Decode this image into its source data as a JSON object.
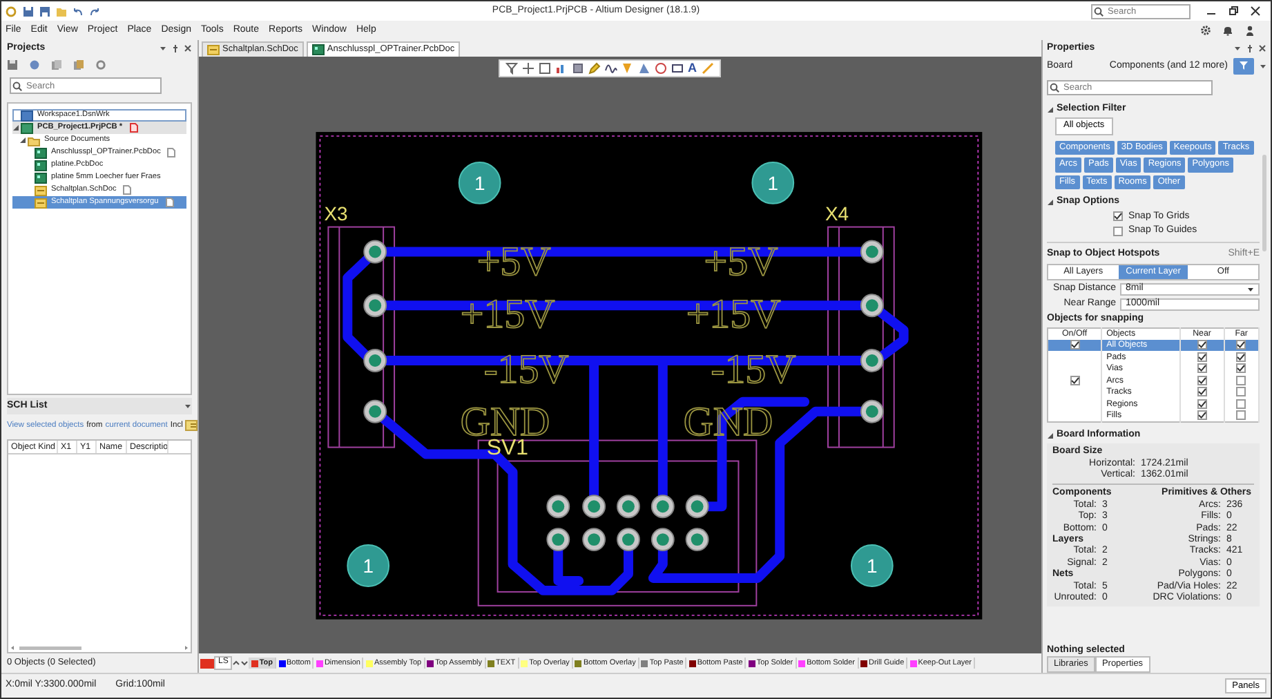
{
  "window": {
    "title": "PCB_Project1.PrjPCB - Altium Designer (18.1.9)",
    "search_placeholder": "Search"
  },
  "menu": [
    "File",
    "Edit",
    "View",
    "Project",
    "Place",
    "Design",
    "Tools",
    "Route",
    "Reports",
    "Window",
    "Help"
  ],
  "projects_panel": {
    "title": "Projects",
    "search_placeholder": "Search",
    "tree": [
      {
        "label": "Workspace1.DsnWrk",
        "kind": "workspace",
        "focused": true,
        "selected": false,
        "open": false
      },
      {
        "label": "PCB_Project1.PrjPCB *",
        "kind": "project",
        "focused": false,
        "selected": false,
        "open": true,
        "expanded": true,
        "children": [
          {
            "label": "Source Documents",
            "kind": "folder",
            "focused": false,
            "selected": false,
            "open": false,
            "expanded": true,
            "children": [
              {
                "label": "Anschlusspl_OPTrainer.PcbDoc",
                "kind": "pcb",
                "focused": false,
                "selected": false,
                "open": true
              },
              {
                "label": "platine.PcbDoc",
                "kind": "pcb",
                "focused": false,
                "selected": false,
                "open": false
              },
              {
                "label": "platine 5mm Loecher fuer Fraes",
                "kind": "pcb",
                "focused": false,
                "selected": false,
                "open": false
              },
              {
                "label": "Schaltplan.SchDoc",
                "kind": "sch",
                "focused": false,
                "selected": false,
                "open": true
              },
              {
                "label": "Schaltplan Spannungsversorgu",
                "kind": "sch",
                "focused": false,
                "selected": true,
                "open": true
              }
            ]
          }
        ]
      }
    ]
  },
  "sch_list": {
    "title": "SCH List",
    "description": [
      {
        "text": "View selected objects",
        "kind": "link"
      },
      {
        "text": "from",
        "kind": "plain"
      },
      {
        "text": "current document",
        "kind": "link"
      },
      {
        "text": "Incl",
        "kind": "plain"
      }
    ],
    "columns": [
      "Object Kind",
      "X1",
      "Y1",
      "Name",
      "Descriptio"
    ],
    "footer": "0 Objects (0 Selected)"
  },
  "doc_tabs": [
    {
      "label": "Schaltplan.SchDoc",
      "kind": "sch",
      "selected": false
    },
    {
      "label": "Anschlusspl_OPTrainer.PcbDoc",
      "kind": "pcb",
      "selected": true
    }
  ],
  "canvas_toolbar": {
    "text_tool_label": "A"
  },
  "pcb": {
    "designators": [
      "X3",
      "X4",
      "SV1"
    ],
    "net_labels": [
      "+5V",
      "+5V",
      "+15V",
      "+15V",
      "-15V",
      "-15V",
      "GND",
      "GND"
    ],
    "hole_labels": [
      "1",
      "1",
      "1",
      "1"
    ]
  },
  "layer_bar": {
    "current_layer": {
      "color": "#e03020"
    },
    "set_label": "LS",
    "layers": [
      {
        "name": "Top",
        "color": "#e03020",
        "selected": true
      },
      {
        "name": "Bottom",
        "color": "#0000ff",
        "selected": false
      },
      {
        "name": "Dimension",
        "color": "#ff40ff",
        "selected": false
      },
      {
        "name": "Assembly Top",
        "color": "#ffff60",
        "selected": false
      },
      {
        "name": "Top Assembly",
        "color": "#800080",
        "selected": false
      },
      {
        "name": "TEXT",
        "color": "#808020",
        "selected": false
      },
      {
        "name": "Top Overlay",
        "color": "#ffff80",
        "selected": false
      },
      {
        "name": "Bottom Overlay",
        "color": "#808020",
        "selected": false
      },
      {
        "name": "Top Paste",
        "color": "#808080",
        "selected": false
      },
      {
        "name": "Bottom Paste",
        "color": "#800000",
        "selected": false
      },
      {
        "name": "Top Solder",
        "color": "#800080",
        "selected": false
      },
      {
        "name": "Bottom Solder",
        "color": "#ff40ff",
        "selected": false
      },
      {
        "name": "Drill Guide",
        "color": "#800000",
        "selected": false
      },
      {
        "name": "Keep-Out Layer",
        "color": "#ff40ff",
        "selected": false
      }
    ]
  },
  "properties": {
    "title": "Properties",
    "object": "Board",
    "filter_summary": "Components (and 12 more)",
    "search_placeholder": "Search",
    "selection_filter": {
      "title": "Selection Filter",
      "expanded": true,
      "all_label": "All objects",
      "filters": [
        {
          "label": "Components",
          "selected": true
        },
        {
          "label": "3D Bodies",
          "selected": true
        },
        {
          "label": "Keepouts",
          "selected": true
        },
        {
          "label": "Tracks",
          "selected": true
        },
        {
          "label": "Arcs",
          "selected": true
        },
        {
          "label": "Pads",
          "selected": true
        },
        {
          "label": "Vias",
          "selected": true
        },
        {
          "label": "Regions",
          "selected": true
        },
        {
          "label": "Polygons",
          "selected": true
        },
        {
          "label": "Fills",
          "selected": true
        },
        {
          "label": "Texts",
          "selected": true
        },
        {
          "label": "Rooms",
          "selected": true
        },
        {
          "label": "Other",
          "selected": true
        }
      ]
    },
    "snap_options": {
      "title": "Snap Options",
      "expanded": true,
      "checks": [
        {
          "label": "Snap To Grids",
          "checked": true
        },
        {
          "label": "Snap To Guides",
          "checked": false
        }
      ],
      "hotspots_title": "Snap to Object Hotspots",
      "hotspots_shortcut": "Shift+E",
      "hotspot_modes": [
        {
          "label": "All Layers",
          "selected": false
        },
        {
          "label": "Current Layer",
          "selected": true
        },
        {
          "label": "Off",
          "selected": false
        }
      ],
      "snap_distance_label": "Snap Distance",
      "snap_distance": "8mil",
      "near_range_label": "Near Range",
      "near_range": "1000mil",
      "objects_title": "Objects for snapping",
      "columns": [
        "On/Off",
        "Objects",
        "Near",
        "Far"
      ],
      "rows": [
        {
          "name": "All Objects",
          "on": true,
          "near": true,
          "far": true,
          "selected": true
        },
        {
          "name": "Pads",
          "on": false,
          "near": true,
          "far": true,
          "selected": false
        },
        {
          "name": "Vias",
          "on": false,
          "near": true,
          "far": true,
          "selected": false
        },
        {
          "name": "Arcs",
          "on": true,
          "near": true,
          "far": false,
          "selected": false
        },
        {
          "name": "Tracks",
          "on": false,
          "near": true,
          "far": false,
          "selected": false
        },
        {
          "name": "Regions",
          "on": false,
          "near": true,
          "far": false,
          "selected": false
        },
        {
          "name": "Fills",
          "on": false,
          "near": true,
          "far": false,
          "selected": false
        }
      ]
    },
    "board_information": {
      "title": "Board Information",
      "expanded": true,
      "size_title": "Board Size",
      "size": [
        {
          "label": "Horizontal:",
          "value": "1724.21mil"
        },
        {
          "label": "Vertical:",
          "value": "1362.01mil"
        }
      ],
      "left_groups": [
        {
          "title": "Components",
          "items": [
            {
              "label": "Total:",
              "value": "3"
            },
            {
              "label": "Top:",
              "value": "3"
            },
            {
              "label": "Bottom:",
              "value": "0"
            }
          ]
        },
        {
          "title": "Layers",
          "items": [
            {
              "label": "Total:",
              "value": "2"
            },
            {
              "label": "Signal:",
              "value": "2"
            }
          ]
        },
        {
          "title": "Nets",
          "items": [
            {
              "label": "Total:",
              "value": "5"
            },
            {
              "label": "Unrouted:",
              "value": "0"
            }
          ]
        }
      ],
      "right_title": "Primitives & Others",
      "right_items": [
        {
          "label": "Arcs:",
          "value": "236"
        },
        {
          "label": "Fills:",
          "value": "0"
        },
        {
          "label": "Pads:",
          "value": "22"
        },
        {
          "label": "Strings:",
          "value": "8"
        },
        {
          "label": "Tracks:",
          "value": "421"
        },
        {
          "label": "Vias:",
          "value": "0"
        },
        {
          "label": "Polygons:",
          "value": "0"
        },
        {
          "label": "Pad/Via Holes:",
          "value": "22"
        },
        {
          "label": "DRC Violations:",
          "value": "0"
        }
      ]
    },
    "selection_status": "Nothing selected",
    "bottom_tabs": [
      {
        "label": "Libraries",
        "selected": false
      },
      {
        "label": "Properties",
        "selected": true
      }
    ]
  },
  "status_bar": {
    "coordinates": "X:0mil Y:3300.000mil",
    "grid": "Grid:100mil",
    "panels_button": "Panels"
  }
}
